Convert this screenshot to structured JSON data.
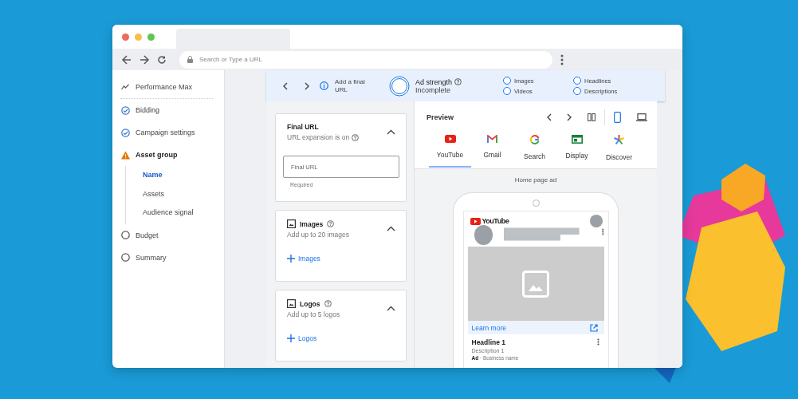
{
  "browser": {
    "address_placeholder": "Search or Type a URL"
  },
  "sidebar": {
    "items": [
      {
        "label": "Performance Max",
        "kind": "overview",
        "selected": false
      },
      {
        "label": "Bidding",
        "kind": "complete",
        "selected": false
      },
      {
        "label": "Campaign settings",
        "kind": "complete",
        "selected": false
      },
      {
        "label": "Asset group",
        "kind": "warning",
        "selected": false,
        "children": [
          {
            "label": "Name",
            "selected": true
          },
          {
            "label": "Assets",
            "selected": false
          },
          {
            "label": "Audience signal",
            "selected": false
          }
        ]
      },
      {
        "label": "Budget",
        "kind": "pending",
        "selected": false
      },
      {
        "label": "Summary",
        "kind": "pending",
        "selected": false
      }
    ]
  },
  "banner": {
    "hint": "Add a final URL",
    "strength_label": "Ad strength",
    "strength_value": "Incomplete",
    "checklist": [
      {
        "label": "Images",
        "checked": false
      },
      {
        "label": "Headlines",
        "checked": false
      },
      {
        "label": "Videos",
        "checked": false
      },
      {
        "label": "Descriptions",
        "checked": false
      }
    ]
  },
  "cards": [
    {
      "kind": "url",
      "title": "Final URL",
      "subtitle": "URL expansion is on",
      "expanded": true,
      "placeholder": "Final URL",
      "helper": "Required"
    },
    {
      "kind": "images",
      "title": "Images",
      "subtitle": "Add up to 20 images",
      "expanded": true,
      "add": "Images"
    },
    {
      "kind": "logos",
      "title": "Logos",
      "subtitle": "Add up to 5 logos",
      "expanded": true,
      "add": "Logos"
    }
  ],
  "preview": {
    "title": "Preview",
    "devices": [
      {
        "kind": "mobile",
        "selected": true
      },
      {
        "kind": "desktop",
        "selected": false
      }
    ],
    "channels": [
      {
        "label": "YouTube",
        "kind": "youtube",
        "selected": true
      },
      {
        "label": "Gmail",
        "kind": "gmail",
        "selected": false
      },
      {
        "label": "Search",
        "kind": "search",
        "selected": false
      },
      {
        "label": "Display",
        "kind": "display",
        "selected": false
      },
      {
        "label": "Discover",
        "kind": "discover",
        "selected": false
      }
    ],
    "format": "Home page ad",
    "ad": {
      "brand": "YouTube",
      "cta": "Learn more",
      "headline": "Headline 1",
      "description": "Description 1",
      "byline": "**Ad** · Business name"
    }
  }
}
